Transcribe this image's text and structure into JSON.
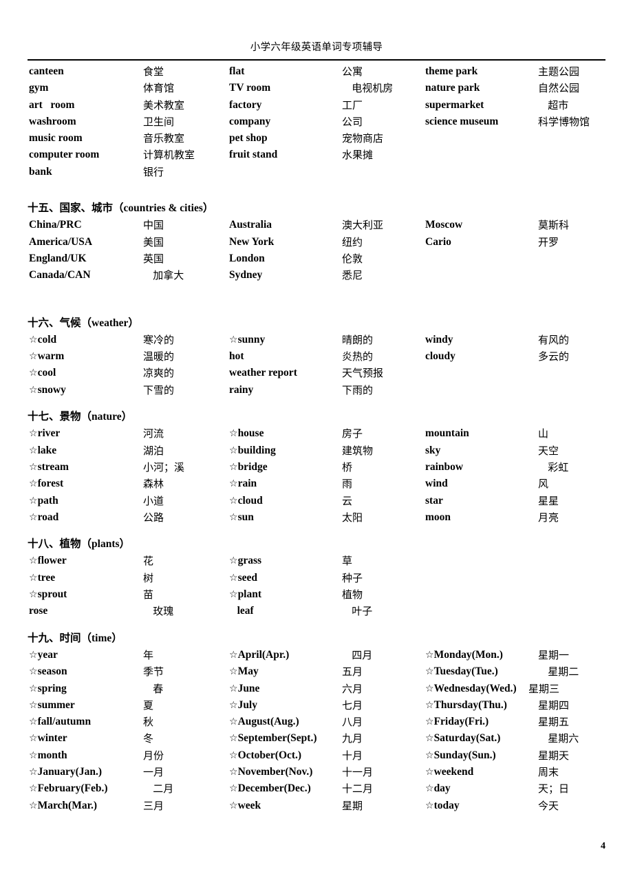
{
  "document": {
    "header_title": "小学六年级英语单词专项辅导",
    "page_number": "4"
  },
  "sections": [
    {
      "id": "places",
      "title": null,
      "rows": [
        {
          "c1en": "canteen",
          "c1zh": "食堂",
          "c2en": "flat",
          "c2zh": "公寓",
          "c3en": "theme park",
          "c3zh": "主题公园"
        },
        {
          "c1en": "gym",
          "c1zh": "体育馆",
          "c2en": "TV room",
          "c2zh": "   电视机房",
          "c3en": "nature park",
          "c3zh": "自然公园"
        },
        {
          "c1en": "art   room",
          "c1zh": "美术教室",
          "c2en": "factory",
          "c2zh": "工厂",
          "c3en": "supermarket",
          "c3zh": "   超市"
        },
        {
          "c1en": "washroom",
          "c1zh": "卫生间",
          "c2en": "company",
          "c2zh": "公司",
          "c3en": "science museum",
          "c3zh": "科学博物馆"
        },
        {
          "c1en": "music room",
          "c1zh": "音乐教室",
          "c2en": "pet shop",
          "c2zh": "宠物商店",
          "c3en": "",
          "c3zh": ""
        },
        {
          "c1en": "computer room",
          "c1zh": "计算机教室",
          "c2en": "fruit stand",
          "c2zh": "水果摊",
          "c3en": "",
          "c3zh": ""
        },
        {
          "c1en": "bank",
          "c1zh": "银行",
          "c2en": "",
          "c2zh": "",
          "c3en": "",
          "c3zh": ""
        }
      ]
    },
    {
      "id": "countries-cities",
      "title": "十五、国家、城市（countries & cities）",
      "title_cn": "十五、国家、城市（",
      "title_latin": "countries & cities",
      "title_tail": "）",
      "rows": [
        {
          "c1en": "China/PRC",
          "c1zh": "中国",
          "c2en": "Australia",
          "c2zh": "澳大利亚",
          "c3en": "Moscow",
          "c3zh": "莫斯科"
        },
        {
          "c1en": "America/USA",
          "c1zh": "美国",
          "c2en": "New York",
          "c2zh": "纽约",
          "c3en": "Cario",
          "c3zh": "开罗"
        },
        {
          "c1en": "England/UK",
          "c1zh": "英国",
          "c2en": "London",
          "c2zh": "伦敦",
          "c3en": "",
          "c3zh": ""
        },
        {
          "c1en": "Canada/CAN",
          "c1zh": "   加拿大",
          "c2en": "Sydney",
          "c2zh": "悉尼",
          "c3en": "",
          "c3zh": ""
        }
      ]
    },
    {
      "id": "weather",
      "title": "十六、气候（weather）",
      "title_cn": "十六、气候（",
      "title_latin": "weather",
      "title_tail": "）",
      "rows": [
        {
          "c1star": true,
          "c1en": "cold",
          "c1zh": "寒冷的",
          "c2star": true,
          "c2en": "sunny",
          "c2zh": "晴朗的",
          "c3en": "windy",
          "c3zh": "有风的"
        },
        {
          "c1star": true,
          "c1en": "warm",
          "c1zh": "温暖的",
          "c2star": false,
          "c2en": "hot",
          "c2zh": "炎热的",
          "c3en": "cloudy",
          "c3zh": "多云的"
        },
        {
          "c1star": true,
          "c1en": "cool",
          "c1zh": "凉爽的",
          "c2star": false,
          "c2en": "weather report",
          "c2zh": "天气预报",
          "c3en": "",
          "c3zh": ""
        },
        {
          "c1star": true,
          "c1en": "snowy",
          "c1zh": "下雪的",
          "c2star": false,
          "c2en": "rainy",
          "c2zh": "下雨的",
          "c3en": "",
          "c3zh": ""
        }
      ]
    },
    {
      "id": "nature",
      "title": "十七、景物（nature）",
      "title_cn": "十七、景物（",
      "title_latin": "nature",
      "title_tail": "）",
      "rows": [
        {
          "c1star": true,
          "c1en": "river",
          "c1zh": "河流",
          "c2star": true,
          "c2en": "house",
          "c2zh": "房子",
          "c3en": "mountain",
          "c3zh": "山"
        },
        {
          "c1star": true,
          "c1en": "lake",
          "c1zh": "湖泊",
          "c2star": true,
          "c2en": "building",
          "c2zh": "建筑物",
          "c3en": "sky",
          "c3zh": "天空"
        },
        {
          "c1star": true,
          "c1en": "stream",
          "c1zh": "小河；溪",
          "c2star": true,
          "c2en": "bridge",
          "c2zh": "桥",
          "c3en": "rainbow",
          "c3zh": "   彩虹"
        },
        {
          "c1star": true,
          "c1en": "forest",
          "c1zh": "森林",
          "c2star": true,
          "c2en": "rain",
          "c2zh": "雨",
          "c3en": "wind",
          "c3zh": "风"
        },
        {
          "c1star": true,
          "c1en": "path",
          "c1zh": "小道",
          "c2star": true,
          "c2en": "cloud",
          "c2zh": "云",
          "c3en": "star",
          "c3zh": "星星"
        },
        {
          "c1star": true,
          "c1en": "road",
          "c1zh": "公路",
          "c2star": true,
          "c2en": "sun",
          "c2zh": "太阳",
          "c3en": "moon",
          "c3zh": "月亮"
        }
      ]
    },
    {
      "id": "plants",
      "title": "十八、植物（plants）",
      "title_cn": "十八、植物（",
      "title_latin": "plants",
      "title_tail": "）",
      "rows": [
        {
          "c1star": true,
          "c1en": "flower",
          "c1zh": "花",
          "c2star": true,
          "c2en": "grass",
          "c2zh": "草"
        },
        {
          "c1star": true,
          "c1en": "tree",
          "c1zh": "树",
          "c2star": true,
          "c2en": "seed",
          "c2zh": "种子"
        },
        {
          "c1star": true,
          "c1en": "sprout",
          "c1zh": "苗",
          "c2star": true,
          "c2en": "plant",
          "c2zh": "植物"
        },
        {
          "c1star": false,
          "c1en": "rose",
          "c1zh": "   玫瑰",
          "c2star": false,
          "c2en": "   leaf",
          "c2zh": "   叶子"
        }
      ]
    },
    {
      "id": "time",
      "title": "十九、时间（time）",
      "title_cn": "十九、时间（",
      "title_latin": "time",
      "title_tail": "）",
      "rows": [
        {
          "c1star": true,
          "c1en": "year",
          "c1zh": "年",
          "c2star": true,
          "c2en": "April(Apr.)",
          "c2zh": "   四月",
          "c3star": true,
          "c3en": "Monday(Mon.)",
          "c3zh": "星期一"
        },
        {
          "c1star": true,
          "c1en": "season",
          "c1zh": "季节",
          "c2star": true,
          "c2en": "May",
          "c2zh": "五月",
          "c3star": true,
          "c3en": "Tuesday(Tue.)",
          "c3zh": "   星期二"
        },
        {
          "c1star": true,
          "c1en": "spring",
          "c1zh": "   春",
          "c2star": true,
          "c2en": "June",
          "c2zh": "六月",
          "c3star": true,
          "c3en": "Wednesday(Wed.)",
          "c3zh": "星期三",
          "c3tight": true
        },
        {
          "c1star": true,
          "c1en": "summer",
          "c1zh": "夏",
          "c2star": true,
          "c2en": "July",
          "c2zh": "七月",
          "c3star": true,
          "c3en": "Thursday(Thu.)",
          "c3zh": "星期四"
        },
        {
          "c1star": true,
          "c1en": "fall/autumn",
          "c1zh": "秋",
          "c2star": true,
          "c2en": "August(Aug.)",
          "c2zh": "八月",
          "c3star": true,
          "c3en": "Friday(Fri.)",
          "c3zh": "星期五"
        },
        {
          "c1star": true,
          "c1en": "winter",
          "c1zh": "冬",
          "c2star": true,
          "c2en": "September(Sept.)",
          "c2zh": "九月",
          "c3star": true,
          "c3en": "Saturday(Sat.)",
          "c3zh": "   星期六"
        },
        {
          "c1star": true,
          "c1en": "month",
          "c1zh": "月份",
          "c2star": true,
          "c2en": "October(Oct.)",
          "c2zh": "十月",
          "c3star": true,
          "c3en": "Sunday(Sun.)",
          "c3zh": "星期天"
        },
        {
          "c1star": true,
          "c1en": "January(Jan.)",
          "c1zh": "一月",
          "c2star": true,
          "c2en": "November(Nov.)",
          "c2zh": "十一月",
          "c3star": true,
          "c3en": "weekend",
          "c3zh": "周末"
        },
        {
          "c1star": true,
          "c1en": "February(Feb.)",
          "c1zh": "   二月",
          "c2star": true,
          "c2en": "December(Dec.)",
          "c2zh": "十二月",
          "c3star": true,
          "c3en": "day",
          "c3zh": "天；日"
        },
        {
          "c1star": true,
          "c1en": "March(Mar.)",
          "c1zh": "三月",
          "c2star": true,
          "c2en": "week",
          "c2zh": "星期",
          "c3star": true,
          "c3en": "today",
          "c3zh": "今天"
        }
      ]
    }
  ]
}
